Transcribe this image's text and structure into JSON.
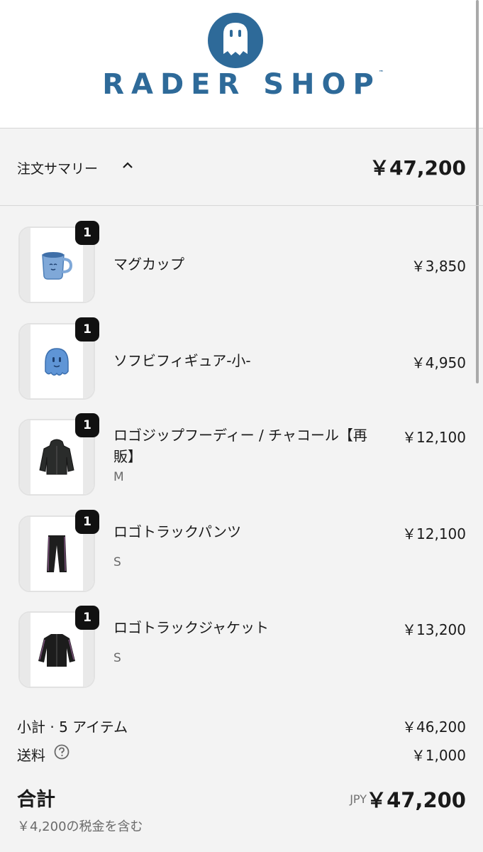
{
  "header": {
    "logo_text": "RADER SHOP",
    "trademark": "™",
    "brand_color": "#2e6a99",
    "logo_icon": "ghost-face-icon"
  },
  "summary": {
    "label": "注文サマリー",
    "toggle_icon": "chevron-up-icon",
    "total": "￥47,200"
  },
  "items": [
    {
      "qty": "1",
      "name": "マグカップ",
      "variant": "",
      "price": "￥3,850",
      "icon": "mug-icon"
    },
    {
      "qty": "1",
      "name": "ソフビフィギュア-小-",
      "variant": "",
      "price": "￥4,950",
      "icon": "figure-icon"
    },
    {
      "qty": "1",
      "name": "ロゴジップフーディー / チャコール【再販】",
      "variant": "M",
      "price": "￥12,100",
      "icon": "hoodie-icon"
    },
    {
      "qty": "1",
      "name": "ロゴトラックパンツ",
      "variant": "S",
      "price": "￥12,100",
      "icon": "pants-icon"
    },
    {
      "qty": "1",
      "name": "ロゴトラックジャケット",
      "variant": "S",
      "price": "￥13,200",
      "icon": "jacket-icon"
    }
  ],
  "totals": {
    "subtotal_label": "小計 · 5 アイテム",
    "subtotal_value": "￥46,200",
    "shipping_label": "送料",
    "shipping_help_icon": "question-circle-icon",
    "shipping_value": "￥1,000",
    "total_label": "合計",
    "currency": "JPY",
    "total_value": "￥47,200",
    "tax_note": "￥4,200の税金を含む"
  }
}
